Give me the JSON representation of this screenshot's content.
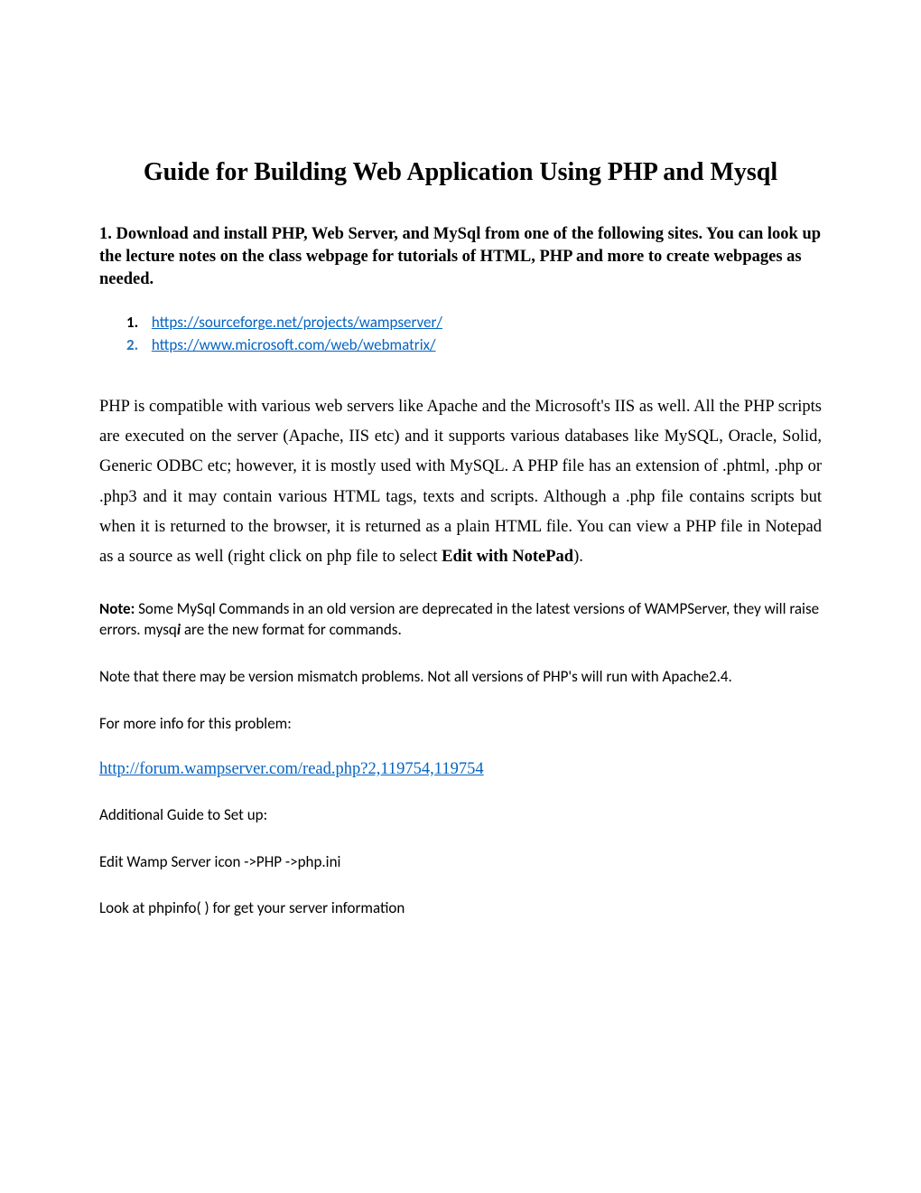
{
  "title": "Guide for Building Web Application Using PHP and Mysql",
  "section1": "1. Download and install PHP, Web Server, and MySql from one of the following sites. You can look up the lecture notes on the class webpage for tutorials of HTML, PHP and more to create webpages as needed.",
  "links": {
    "num1": "1.",
    "link1": "https://sourceforge.net/projects/wampserver/",
    "num2": "2.",
    "link2": "https://www.microsoft.com/web/webmatrix/"
  },
  "body_part1": "PHP is compatible with various web servers like Apache and the Microsoft's IIS as well. All the PHP scripts are executed on the server (Apache, IIS etc) and it supports various databases like MySQL, Oracle, Solid, Generic ODBC etc; however, it is mostly used with MySQL.  A PHP file has an extension of .phtml, .php or .php3 and it may contain various HTML tags, texts and scripts. Although a .php file contains scripts but when it is returned to the browser, it is returned as a plain HTML file. You can view a PHP file in Notepad as a source as well (right click on php file to select ",
  "body_bold": "Edit with NotePad",
  "body_part2": ").",
  "note_label": "Note:",
  "note_text1": " Some MySql Commands in an old version are deprecated in the latest versions of WAMPServer, they will raise errors. mysq",
  "note_italic": "i",
  "note_text2": " are the new format for commands.",
  "version_note": "Note that there may be version mismatch problems. Not all versions of PHP's will run with Apache2.4.",
  "more_info": "For more info for this problem:",
  "forum_link": "http://forum.wampserver.com/read.php?2,119754,119754",
  "guide_label": "Additional Guide to Set up:",
  "edit_line": "Edit Wamp Server icon ->PHP ->php.ini",
  "phpinfo_line": "Look at phpinfo( ) for get your server information"
}
